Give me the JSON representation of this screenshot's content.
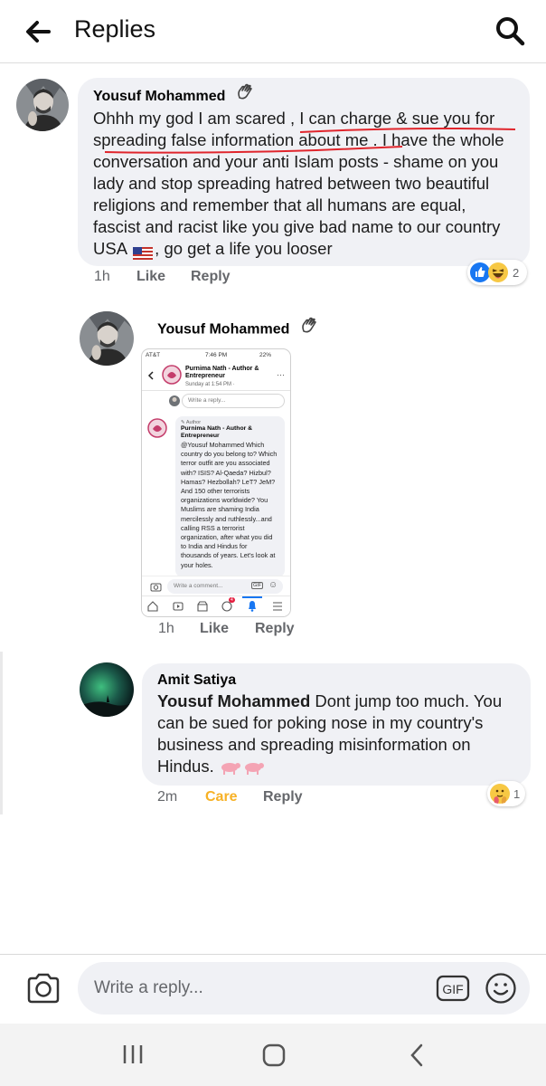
{
  "header": {
    "title": "Replies",
    "back_icon": "arrow-left-icon",
    "search_icon": "search-icon"
  },
  "comments": [
    {
      "author": "Yousuf Mohammed",
      "text_parts": [
        "Ohhh my god I am scared , I can charge & sue you  for spreading  false information about me . I have the whole conversation and your anti Islam posts - shame on you lady  and stop spreading hatred between two beautiful religions and remember that all humans are equal, fascist and racist like you give bad name to our country USA ",
        ", go get a life you looser"
      ],
      "time": "1h",
      "like": "Like",
      "reply": "Reply",
      "reaction_count": "2"
    },
    {
      "author": "Yousuf Mohammed",
      "time": "1h",
      "like": "Like",
      "reply": "Reply",
      "attachment": {
        "status_carrier": "AT&T",
        "status_time": "7:46 PM",
        "status_battery": "22%",
        "page_name": "Purnima Nath -  Author & Entrepreneur",
        "page_time": "Sunday at 1:54 PM ·",
        "reply_placeholder": "Write a reply...",
        "author_tag": "Author",
        "comment_author": "Purnima Nath -  Author & Entrepreneur",
        "comment_text": "@Yousuf Mohammed Which country do you belong to? Which terror outfit are you associated with? ISIS? Al-Qaeda? Hizbul? Hamas? Hezbollah? LeT? JeM? And 150 other terrorists organizations worldwide? You Muslims are shaming India mercilessly and ruthlessly...and calling RSS a terrorist organization, after what you did to India and Hindus for thousands of years. Let's look at your holes.",
        "comment_placeholder": "Write a comment...",
        "gif": "GIF",
        "nav_badge": "4"
      }
    },
    {
      "author": "Amit Satiya",
      "mention": "Yousuf Mohammed",
      "text": " Dont jump too much. You can be sued for poking nose in my country's business and spreading misinformation on Hindus. ",
      "time": "2m",
      "care": "Care",
      "reply": "Reply",
      "reaction_count": "1"
    }
  ],
  "composer": {
    "placeholder": "Write a reply...",
    "gif_label": "GIF"
  },
  "colors": {
    "bubble": "#f0f1f5",
    "meta": "#65676b",
    "care": "#f7b125",
    "like_blue": "#1877f2",
    "underline_red": "#e0252c"
  }
}
